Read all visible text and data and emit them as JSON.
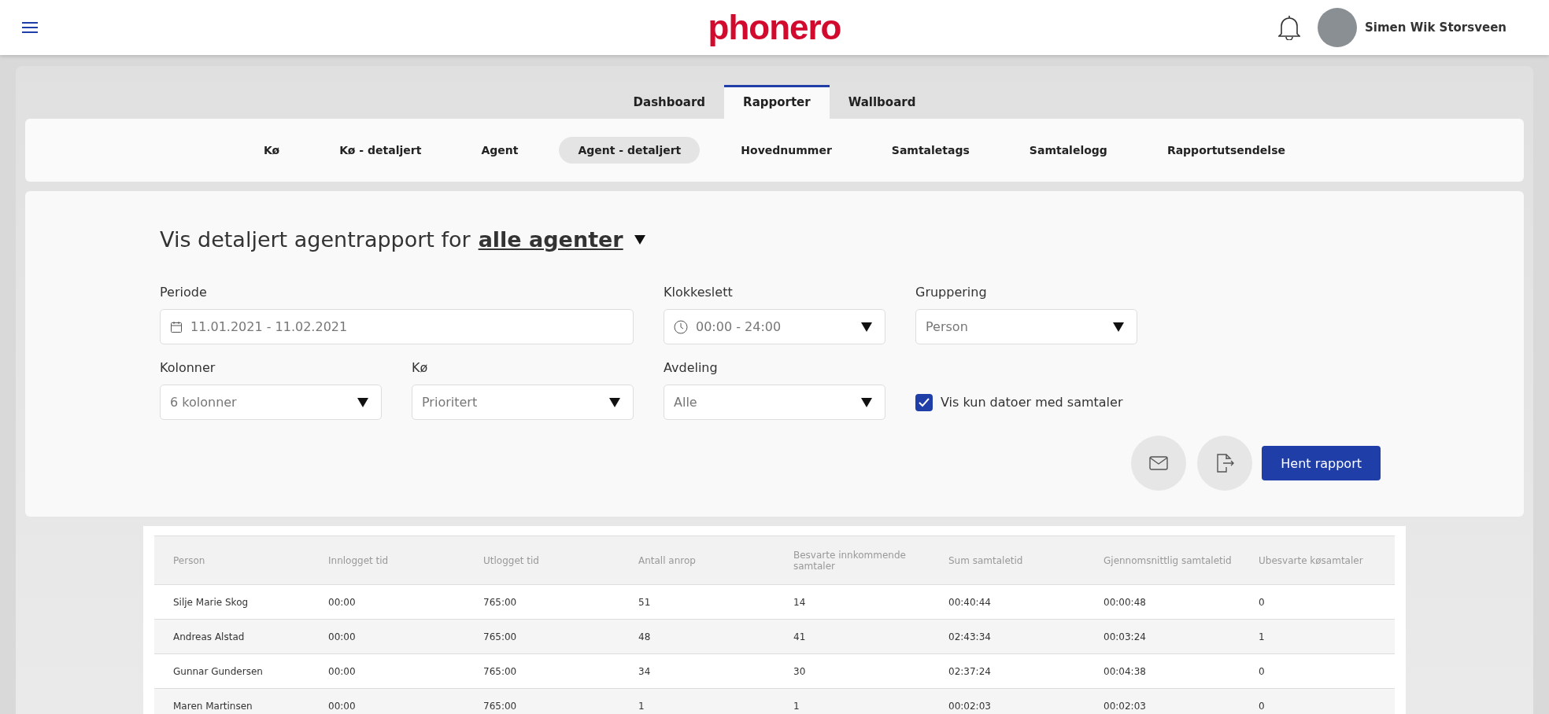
{
  "header": {
    "logo": "phonero",
    "user": {
      "name": "Simen Wik Storsveen"
    }
  },
  "main_tabs": [
    {
      "label": "Dashboard",
      "selected": false
    },
    {
      "label": "Rapporter",
      "selected": true
    },
    {
      "label": "Wallboard",
      "selected": false
    }
  ],
  "sub_tabs": [
    {
      "label": "Kø",
      "selected": false
    },
    {
      "label": "Kø - detaljert",
      "selected": false
    },
    {
      "label": "Agent",
      "selected": false
    },
    {
      "label": "Agent - detaljert",
      "selected": true
    },
    {
      "label": "Hovednummer",
      "selected": false
    },
    {
      "label": "Samtaletags",
      "selected": false
    },
    {
      "label": "Samtalelogg",
      "selected": false
    },
    {
      "label": "Rapportutsendelse",
      "selected": false
    }
  ],
  "report": {
    "title": "Vis detaljert agentrapport for",
    "scope": "alle agenter"
  },
  "filters": [
    {
      "kind": "date",
      "label": "Periode",
      "value": "11.01.2021 - 11.02.2021"
    },
    {
      "kind": "time",
      "label": "Klokkeslett",
      "value": "00:00 - 24:00"
    },
    {
      "kind": "select",
      "label": "Gruppering",
      "value": "Person"
    },
    {
      "kind": "select",
      "label": "Kolonner",
      "value": "6 kolonner"
    },
    {
      "kind": "select",
      "label": "Kø",
      "value": "Prioritert"
    },
    {
      "kind": "select",
      "label": "Avdeling",
      "value": "Alle"
    },
    {
      "kind": "checkbox",
      "label": "Vis kun datoer med samtaler",
      "checked": true
    }
  ],
  "actions": {
    "primary": "Hent rapport"
  },
  "table": {
    "columns": [
      "Person",
      "Innlogget tid",
      "Utlogget tid",
      "Antall anrop",
      "Besvarte innkommende samtaler",
      "Sum samtaletid",
      "Gjennomsnittlig samtaletid",
      "Ubesvarte køsamtaler"
    ],
    "rows": [
      [
        "Silje Marie Skog",
        "00:00",
        "765:00",
        "51",
        "14",
        "00:40:44",
        "00:00:48",
        "0"
      ],
      [
        "Andreas Alstad",
        "00:00",
        "765:00",
        "48",
        "41",
        "02:43:34",
        "00:03:24",
        "1"
      ],
      [
        "Gunnar Gundersen",
        "00:00",
        "765:00",
        "34",
        "30",
        "02:37:24",
        "00:04:38",
        "0"
      ],
      [
        "Maren Martinsen",
        "00:00",
        "765:00",
        "1",
        "1",
        "00:02:03",
        "00:02:03",
        "0"
      ]
    ]
  }
}
